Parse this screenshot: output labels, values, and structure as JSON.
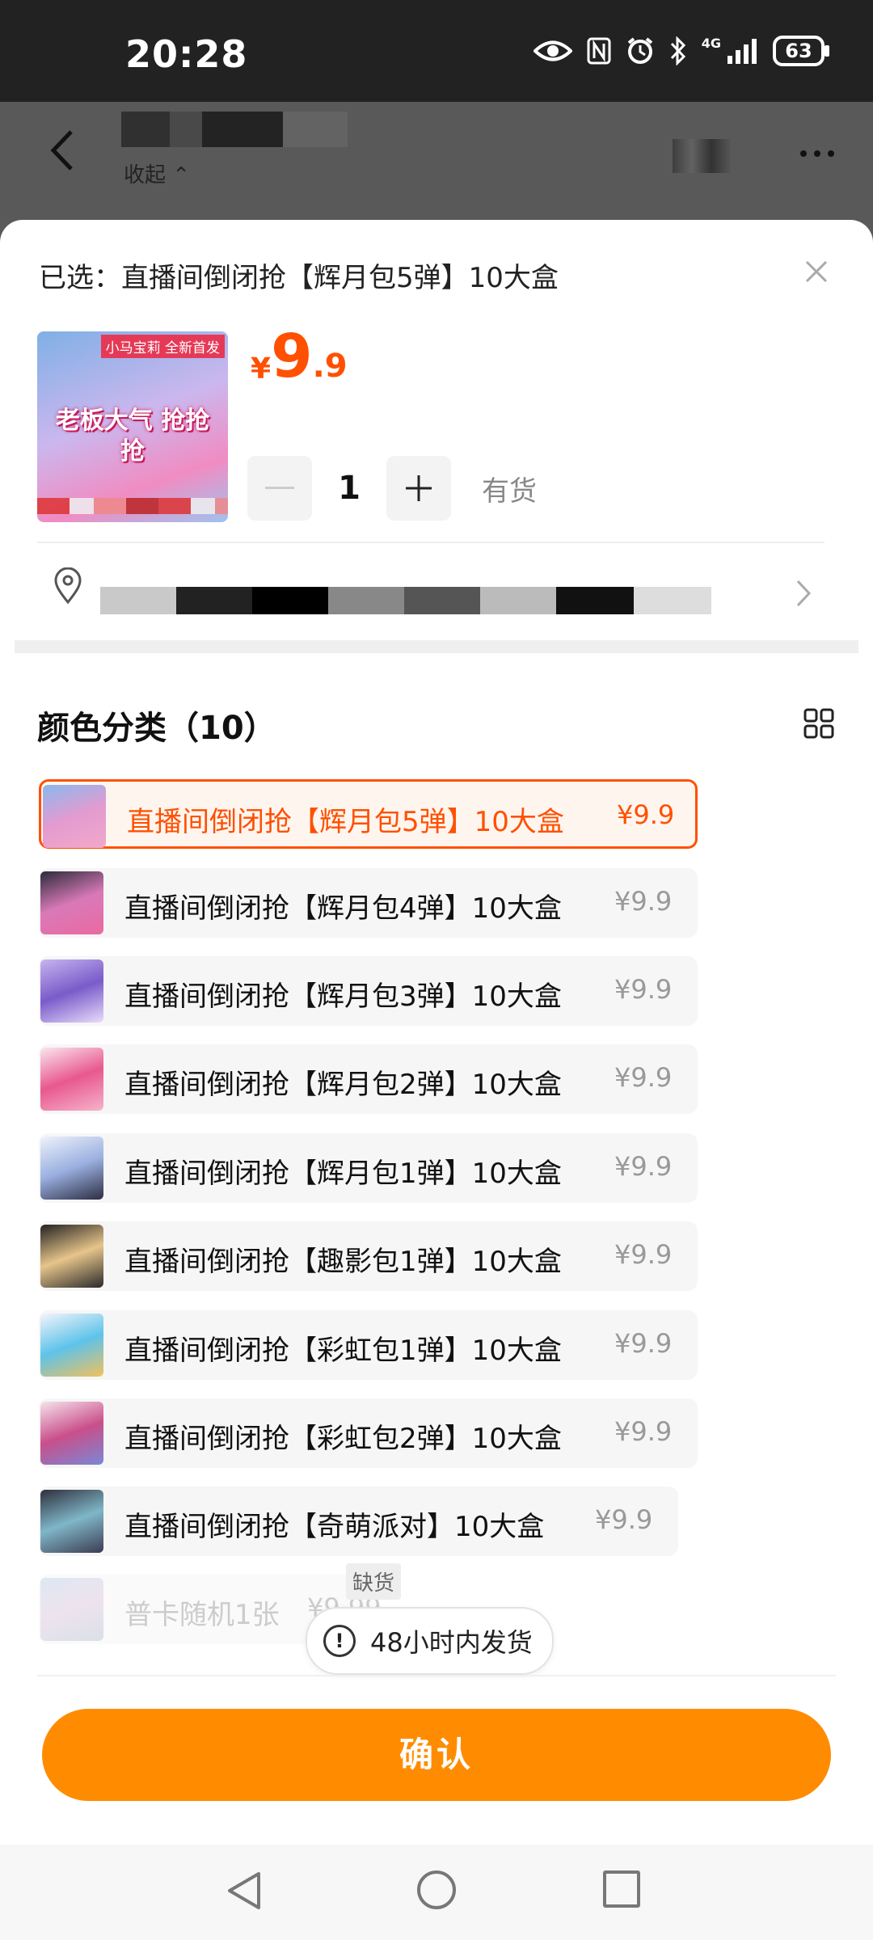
{
  "status_bar": {
    "time": "20:28",
    "network": "4G",
    "battery": "63"
  },
  "header": {
    "collapse_label": "收起"
  },
  "sheet": {
    "selected_label": "已选：",
    "selected_value": "直播间倒闭抢【辉月包5弹】10大盒",
    "product_tag": "小马宝莉 全新首发",
    "product_slogan": "老板大气 抢抢抢",
    "price": {
      "currency": "¥",
      "integer": "9",
      "decimal": ".9"
    },
    "quantity": "1",
    "stock_status": "有货"
  },
  "options_group": {
    "title": "颜色分类（10）",
    "items": [
      {
        "name": "直播间倒闭抢【辉月包5弹】10大盒",
        "price": "¥9.9"
      },
      {
        "name": "直播间倒闭抢【辉月包4弹】10大盒",
        "price": "¥9.9"
      },
      {
        "name": "直播间倒闭抢【辉月包3弹】10大盒",
        "price": "¥9.9"
      },
      {
        "name": "直播间倒闭抢【辉月包2弹】10大盒",
        "price": "¥9.9"
      },
      {
        "name": "直播间倒闭抢【辉月包1弹】10大盒",
        "price": "¥9.9"
      },
      {
        "name": "直播间倒闭抢【趣影包1弹】10大盒",
        "price": "¥9.9"
      },
      {
        "name": "直播间倒闭抢【彩虹包1弹】10大盒",
        "price": "¥9.9"
      },
      {
        "name": "直播间倒闭抢【彩虹包2弹】10大盒",
        "price": "¥9.9"
      },
      {
        "name": "直播间倒闭抢【奇萌派对】10大盒",
        "price": "¥9.9"
      },
      {
        "name": "普卡随机1张",
        "price": "¥9.99"
      }
    ],
    "sold_out_label": "缺货"
  },
  "shipping_notice": "48小时内发货",
  "confirm_label": "确认",
  "colors": {
    "accent": "#ff5000",
    "confirm": "#ff8c00"
  }
}
